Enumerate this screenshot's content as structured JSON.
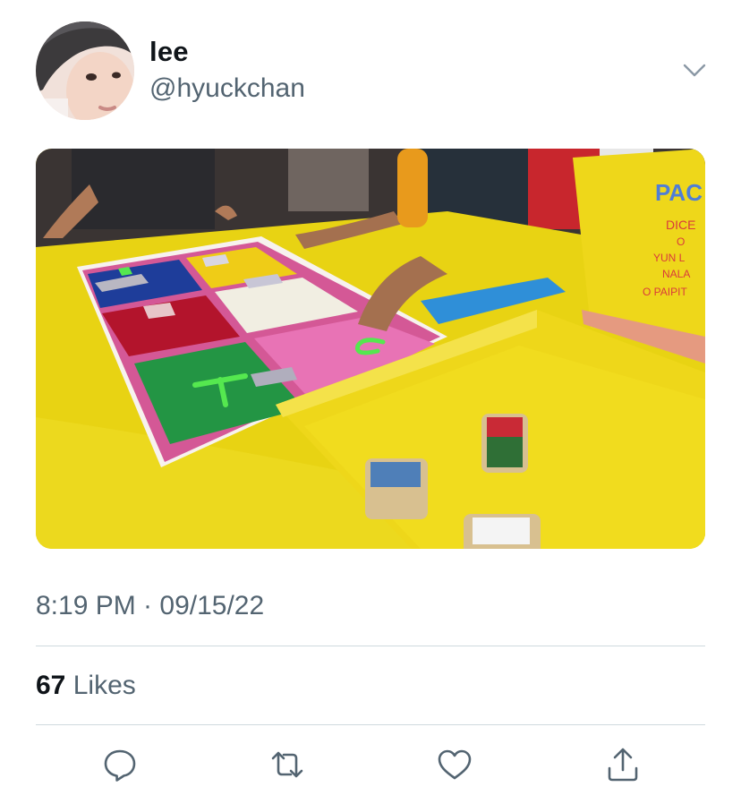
{
  "tweet": {
    "display_name": "lee",
    "handle": "@hyuckchan",
    "avatar_icon": "profile-photo",
    "more_icon": "chevron-down-icon",
    "media": {
      "kind": "photo",
      "board_letters": [
        "D",
        "C",
        "F"
      ],
      "sign_text": [
        "PAC",
        "DICE",
        "O",
        "YUN L",
        "NALA",
        "O PAIPIT"
      ]
    },
    "timestamp": "8:19 PM · 09/15/22",
    "likes": {
      "count": "67",
      "label": "Likes"
    },
    "actions": [
      {
        "name": "reply",
        "icon": "comment-bubble-icon"
      },
      {
        "name": "retweet",
        "icon": "retweet-icon"
      },
      {
        "name": "like",
        "icon": "heart-icon"
      },
      {
        "name": "share",
        "icon": "share-icon"
      }
    ]
  },
  "colors": {
    "text_primary": "#0f1419",
    "text_secondary": "#536471",
    "divider": "#cfd9de",
    "icon": "#536471"
  }
}
